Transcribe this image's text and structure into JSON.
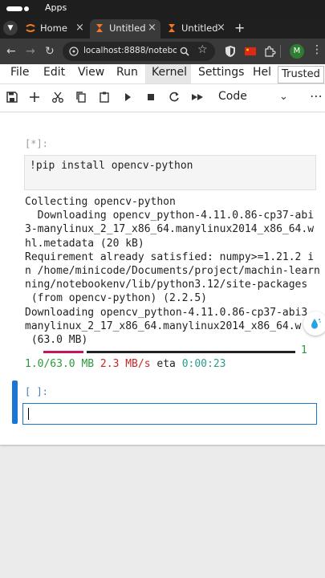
{
  "os": {
    "apps_label": "Apps"
  },
  "browser": {
    "tabs": [
      {
        "label": "Home",
        "icon": "jupyter-icon",
        "close": "×"
      },
      {
        "label": "Untitled",
        "icon": "jupyter-icon",
        "close": "×",
        "active": true
      },
      {
        "label": "Untitled",
        "icon": "jupyter-icon",
        "close": "×"
      }
    ],
    "new_tab": "+",
    "url": "localhost:8888/notebo...",
    "profile_initial": "M"
  },
  "menu": {
    "items": [
      "File",
      "Edit",
      "View",
      "Run",
      "Kernel",
      "Settings",
      "Hel"
    ],
    "trusted": "Trusted"
  },
  "toolbar": {
    "cell_type": "Code"
  },
  "cells": {
    "cell1": {
      "prompt": "[*]:",
      "code": "!pip install opencv-python",
      "output_lines": [
        "Collecting opencv-python",
        "  Downloading opencv_python-4.11.0.86-cp37-abi",
        "3-manylinux_2_17_x86_64.manylinux2014_x86_64.w",
        "hl.metadata (20 kB)",
        "Requirement already satisfied: numpy>=1.21.2 i",
        "n /home/minicode/Documents/project/machin-learn",
        "ning/notebookenv/lib/python3.12/site-packages",
        " (from opencv-python) (2.2.5)",
        "Downloading opencv_python-4.11.0.86-cp37-abi3",
        "manylinux_2_17_x86_64.manylinux2014_x86_64.w",
        " (63.0 MB)"
      ],
      "progress_fraction": 0.016,
      "progress_tail": "1",
      "downloaded": "1.0/63.0 MB",
      "speed": "2.3 MB/s",
      "eta_label": "eta",
      "eta": "0:00:23"
    },
    "cell2": {
      "prompt": "[ ]:"
    }
  },
  "colors": {
    "accent": "#1976d2",
    "progress_done": "#c2185b",
    "progress_rest": "#222222",
    "green": "#2a9a3a",
    "red": "#c62828",
    "teal": "#2a9d8f"
  }
}
